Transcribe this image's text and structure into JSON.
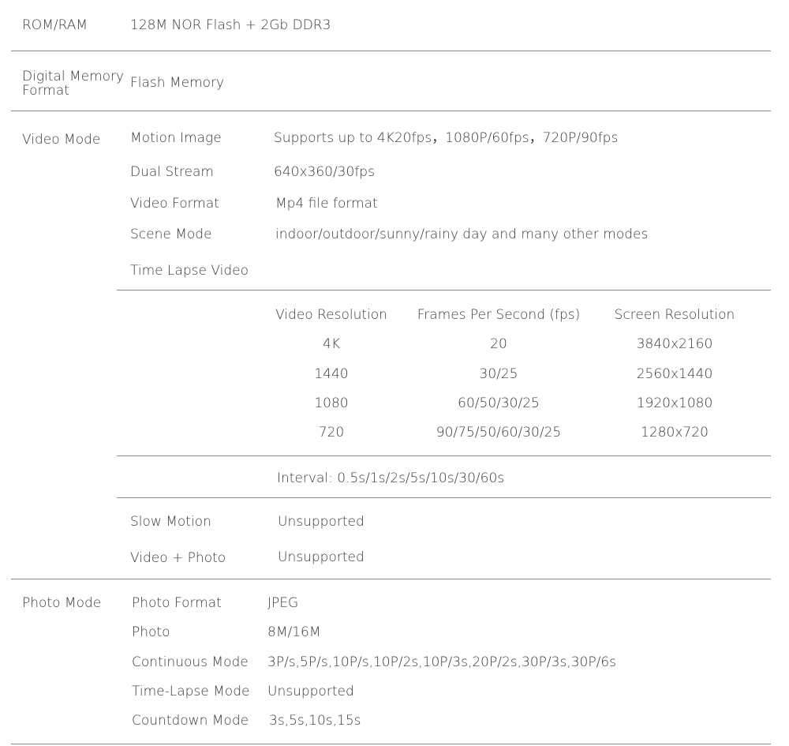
{
  "rom_ram": {
    "label": "ROM/RAM",
    "value": "128M NOR Flash + 2Gb DDR3"
  },
  "memory_format": {
    "label_line1": "Digital Memory",
    "label_line2": "Format",
    "value": "Flash Memory"
  },
  "video_mode": {
    "label": "Video Mode",
    "rows": [
      {
        "label": "Motion Image",
        "value": "Supports up to 4K20fps，1080P/60fps，720P/90fps"
      },
      {
        "label": "Dual Stream",
        "value": "640x360/30fps"
      },
      {
        "label": "Video Format",
        "value": "Mp4 file format"
      },
      {
        "label": "Scene Mode",
        "value": "indoor/outdoor/sunny/rainy day and many other modes"
      },
      {
        "label": "Time Lapse Video",
        "value": ""
      }
    ],
    "table": {
      "headers": [
        "Video Resolution",
        "Frames Per Second (fps)",
        "Screen Resolution"
      ],
      "rows": [
        [
          "4K",
          "20",
          "3840x2160"
        ],
        [
          "1440",
          "30/25",
          "2560x1440"
        ],
        [
          "1080",
          "60/50/30/25",
          "1920x1080"
        ],
        [
          "720",
          "90/75/50/60/30/25",
          "1280x720"
        ]
      ]
    },
    "interval": "Interval: 0.5s/1s/2s/5s/10s/30/60s",
    "slow_motion": {
      "label": "Slow Motion",
      "value": "Unsupported"
    },
    "video_photo": {
      "label": "Video + Photo",
      "value": "Unsupported"
    }
  },
  "photo_mode": {
    "label": "Photo Mode",
    "rows": [
      {
        "label": "Photo Format",
        "value": "JPEG"
      },
      {
        "label": "Photo",
        "value": "8M/16M"
      },
      {
        "label": "Continuous Mode",
        "value": "3P/s,5P/s,10P/s,10P/2s,10P/3s,20P/2s,30P/3s,30P/6s"
      },
      {
        "label": "Time-Lapse Mode",
        "value": "Unsupported"
      },
      {
        "label": "Countdown Mode",
        "value": "3s,5s,10s,15s"
      }
    ]
  }
}
